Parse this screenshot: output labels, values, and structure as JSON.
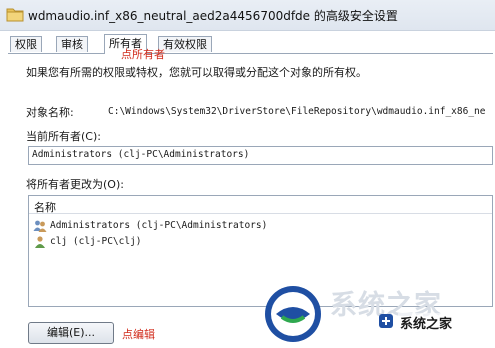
{
  "window": {
    "title": "wdmaudio.inf_x86_neutral_aed2a4456700dfde 的高级安全设置"
  },
  "tabs": [
    {
      "label": "权限",
      "active": false
    },
    {
      "label": "审核",
      "active": false
    },
    {
      "label": "所有者",
      "active": true
    },
    {
      "label": "有效权限",
      "active": false
    }
  ],
  "annotations": {
    "owner_tab": "点所有者",
    "edit": "点编辑"
  },
  "owner_page": {
    "intro": "如果您有所需的权限或特权，您就可以取得或分配这个对象的所有权。",
    "object_name_label": "对象名称:",
    "object_name_value": "C:\\Windows\\System32\\DriverStore\\FileRepository\\wdmaudio.inf_x86_ne",
    "current_owner_label": "当前所有者(C):",
    "current_owner_value": "Administrators (clj-PC\\Administrators)",
    "change_owner_label": "将所有者更改为(O):",
    "list_header": "名称",
    "owners": [
      {
        "name": "Administrators (clj-PC\\Administrators)",
        "icon": "group-users-icon"
      },
      {
        "name": "clj (clj-PC\\clj)",
        "icon": "user-icon"
      }
    ],
    "edit_button": "编辑(E)..."
  },
  "watermark": {
    "big_text": "系统之家",
    "small_text": "系统之家"
  },
  "colors": {
    "annotation": "#d12a1a",
    "title_bar": "#e9eef5",
    "border": "#9aa7b8"
  }
}
